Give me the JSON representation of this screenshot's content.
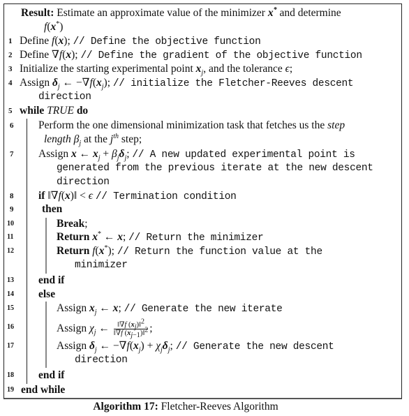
{
  "result": {
    "label": "Result:",
    "text": "Estimate an approximate value of the minimizer",
    "sym_x_star": "x*",
    "and_determine": "and determine",
    "f_x_star": "f(x*)"
  },
  "lines": [
    {
      "num": "1",
      "pre": "Define ",
      "math": "f(x)",
      "sep": ";",
      "comment": "// Define the objective function"
    },
    {
      "num": "2",
      "pre": "Define ",
      "math": "∇f(x)",
      "sep": ";",
      "comment": "// Define the gradient of the objective function"
    },
    {
      "num": "3",
      "text_a": "Initialize the starting experimental point ",
      "math": "x",
      "sub": "j",
      "text_b": ", and the tolerance ",
      "eps": "ϵ",
      "end": ";"
    },
    {
      "num": "4",
      "pre": "Assign ",
      "math": "δ",
      "sub": "j",
      "arrow": " ← −∇f(x",
      "sub2": "j",
      "close": ");",
      "comment": "// initialize the Fletcher-Reeves descent",
      "cont": "direction"
    },
    {
      "num": "5",
      "kw1": "while",
      "cond": "TRUE",
      "kw2": "do"
    },
    {
      "num": "6",
      "text_a": "Perform the one dimensional minimization task that fetches us the ",
      "it_a": "step",
      "it_b": "length",
      "beta": " β",
      "sub": "j",
      "text_b": " at the ",
      "j": "j",
      "sup": "th",
      "text_c": " step;"
    },
    {
      "num": "7",
      "pre": "Assign ",
      "expr_a": "x ← x",
      "sub": "j",
      "expr_b": " + β",
      "sub2": "j",
      "expr_c": "δ",
      "sub3": "j",
      "sep": ";",
      "comment": "// A new updated experimental point is",
      "cont1": "generated from the previous iterate at the new descent",
      "cont2": "direction"
    },
    {
      "num": "8",
      "kw": "if",
      "cond": " ‖∇f(x)‖ < ϵ ",
      "comment": "// Termination condition"
    },
    {
      "num": "9",
      "kw": "then"
    },
    {
      "num": "10",
      "kw": "Break",
      "end": ";"
    },
    {
      "num": "11",
      "kw": "Return",
      "math": " x* ← x",
      "sep": ";",
      "comment": "// Return the minimizer"
    },
    {
      "num": "12",
      "kw": "Return",
      "math": " f(x*)",
      "sep": ";",
      "comment": "// Return the function value at the",
      "cont": "minimizer"
    },
    {
      "num": "13",
      "kw": "end if"
    },
    {
      "num": "14",
      "kw": "else"
    },
    {
      "num": "15",
      "pre": "Assign ",
      "math": "x",
      "sub": "j",
      "rest": " ← x",
      "sep": ";",
      "comment": "// Generate the new iterate"
    },
    {
      "num": "16",
      "pre": "Assign ",
      "chi": "χ",
      "sub": "j",
      "arrow": " ← ",
      "frac_top": "‖∇f (x_j)‖²",
      "frac_bot": "‖∇f (x_{j−1})‖²",
      "end": ";"
    },
    {
      "num": "17",
      "pre": "Assign ",
      "math": "δ",
      "sub": "j",
      "rest": " ← −∇f(x",
      "sub2": "j",
      "rest2": ") + χ",
      "sub3": "j",
      "rest3": "δ",
      "sub4": "j",
      "sep": ";",
      "comment": "// Generate the new descent",
      "cont": "direction"
    },
    {
      "num": "18",
      "kw": "end if"
    },
    {
      "num": "19",
      "kw": "end while"
    }
  ],
  "caption": {
    "label": "Algorithm 17:",
    "title": "Fletcher-Reeves Algorithm"
  }
}
